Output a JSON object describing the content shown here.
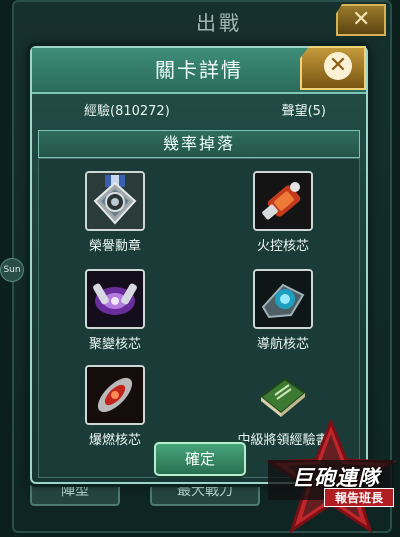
{
  "background": {
    "title": "出戰",
    "buttons": [
      "陣型",
      "最大戰力"
    ],
    "side_badge": "Sun",
    "info_icon": "i"
  },
  "dialog": {
    "title": "關卡詳情",
    "close_icon": "close-icon",
    "stats": {
      "experience": "經驗(810272)",
      "reputation": "聲望(5)"
    },
    "drops_header": "幾率掉落",
    "drops": [
      {
        "label": "榮譽勳章",
        "icon": "medal-icon"
      },
      {
        "label": "火控核芯",
        "icon": "fire-control-core-icon"
      },
      {
        "label": "聚變核芯",
        "icon": "fusion-core-icon"
      },
      {
        "label": "導航核芯",
        "icon": "navigation-core-icon"
      },
      {
        "label": "爆燃核芯",
        "icon": "deflagration-core-icon"
      },
      {
        "label": "中級將領經驗書",
        "icon": "experience-book-icon"
      }
    ],
    "confirm_label": "確定"
  },
  "logo": {
    "line1": "巨砲連隊",
    "line2": "報告班長"
  },
  "colors": {
    "accent": "#3e8e79",
    "gold": "#c49a3c",
    "confirm": "#48a57a",
    "logo_red": "#c0272d"
  }
}
